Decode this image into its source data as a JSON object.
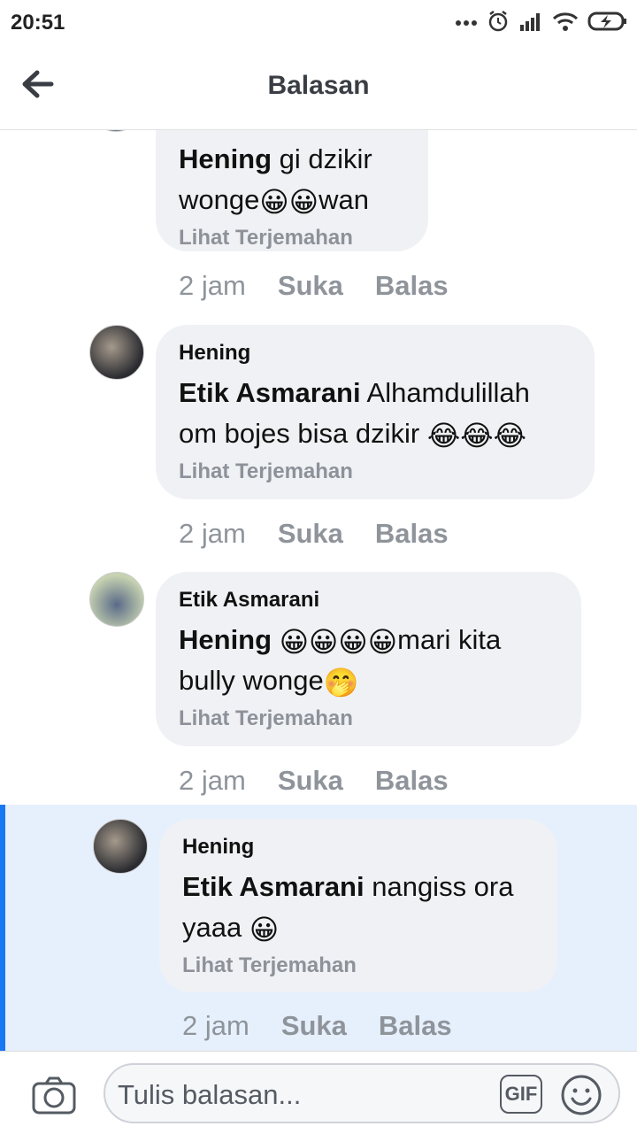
{
  "status_bar": {
    "time": "20:51"
  },
  "header": {
    "title": "Balasan"
  },
  "comments": [
    {
      "mention": "Hening",
      "text_parts": [
        " gi dzikir wonge",
        "😀",
        "😀",
        "wan"
      ],
      "translate": "Lihat Terjemahan",
      "time": "2 jam",
      "like": "Suka",
      "reply": "Balas"
    },
    {
      "author": "Hening",
      "mention": "Etik Asmarani",
      "text_parts": [
        " Alhamdulillah om bojes bisa dzikir ",
        "😂",
        "😂",
        "😂"
      ],
      "translate": "Lihat Terjemahan",
      "time": "2 jam",
      "like": "Suka",
      "reply": "Balas"
    },
    {
      "author": "Etik Asmarani",
      "mention": "Hening",
      "text_parts": [
        " ",
        "😀",
        "😀",
        "😀",
        "😀",
        "mari kita bully wonge",
        "🤭"
      ],
      "translate": "Lihat Terjemahan",
      "time": "2 jam",
      "like": "Suka",
      "reply": "Balas"
    },
    {
      "author": "Hening",
      "mention": "Etik Asmarani",
      "text_parts": [
        " nangiss ora yaaa ",
        "😀"
      ],
      "translate": "Lihat Terjemahan",
      "time": "2 jam",
      "like": "Suka",
      "reply": "Balas"
    }
  ],
  "composer": {
    "placeholder": "Tulis balasan...",
    "gif_label": "GIF"
  },
  "colors": {
    "highlight_bg": "#e6f0fd",
    "highlight_bar": "#1877f2",
    "bubble": "#f0f1f4",
    "meta": "#8f949b"
  }
}
